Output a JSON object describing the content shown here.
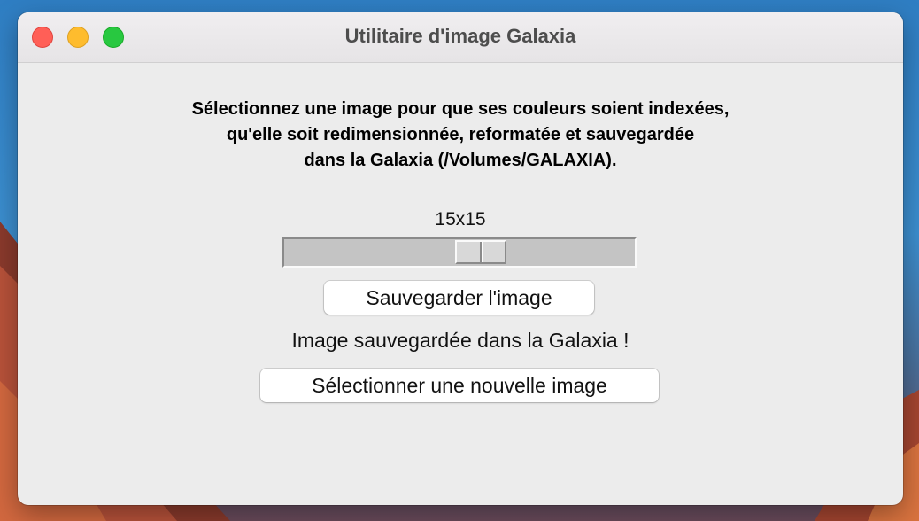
{
  "window": {
    "title": "Utilitaire d'image Galaxia"
  },
  "instructions": {
    "line1": "Sélectionnez une image pour que ses couleurs soient indexées,",
    "line2": "qu'elle soit redimensionnée, reformatée et sauvegardée",
    "line3": "dans la Galaxia (/Volumes/GALAXIA)."
  },
  "size_slider": {
    "label": "15x15",
    "value_fraction": 0.57
  },
  "save_button": {
    "label": "Sauvegarder l'image"
  },
  "status": {
    "text": "Image sauvegardée dans la Galaxia !"
  },
  "select_button": {
    "label": "Sélectionner une nouvelle image"
  },
  "colors": {
    "window_bg": "#ececec",
    "close": "#ff5f57",
    "minimize": "#febc2e",
    "maximize": "#28c840"
  }
}
